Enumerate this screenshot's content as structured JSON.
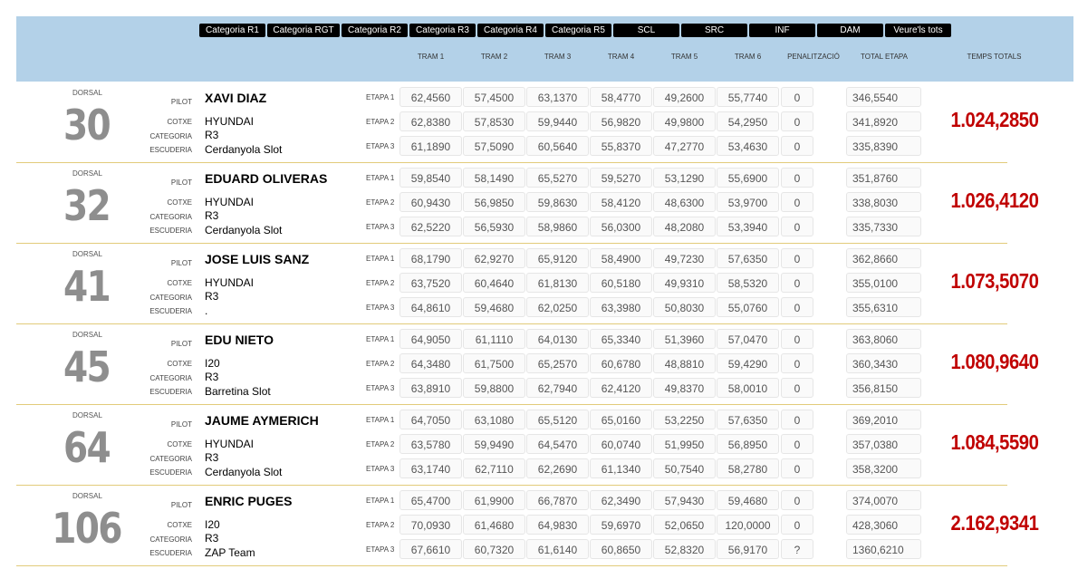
{
  "nav": [
    "Categoria R1",
    "Categoria RGT",
    "Categoria R2",
    "Categoria R3",
    "Categoria R4",
    "Categoria R5",
    "SCL",
    "SRC",
    "INF",
    "DAM",
    "Veure'ls tots"
  ],
  "headers": {
    "tram1": "TRAM 1",
    "tram2": "TRAM 2",
    "tram3": "TRAM 3",
    "tram4": "TRAM 4",
    "tram5": "TRAM 5",
    "tram6": "TRAM 6",
    "pen": "PENALITZACIÓ",
    "total_etapa": "TOTAL ETAPA",
    "temps_totals": "TEMPS TOTALS"
  },
  "labels": {
    "dorsal": "DORSAL",
    "pilot": "PILOT",
    "cotxe": "COTXE",
    "categoria": "CATEGORIA",
    "escuderia": "ESCUDERIA",
    "etapa1": "ETAPA 1",
    "etapa2": "ETAPA 2",
    "etapa3": "ETAPA 3"
  },
  "entries": [
    {
      "dorsal": "30",
      "pilot": "XAVI DIAZ",
      "cotxe": "HYUNDAI",
      "categoria": "R3",
      "escuderia": "Cerdanyola Slot",
      "total": "1.024,2850",
      "etapas": [
        {
          "t": [
            "62,4560",
            "57,4500",
            "63,1370",
            "58,4770",
            "49,2600",
            "55,7740"
          ],
          "pen": "0",
          "total": "346,5540"
        },
        {
          "t": [
            "62,8380",
            "57,8530",
            "59,9440",
            "56,9820",
            "49,9800",
            "54,2950"
          ],
          "pen": "0",
          "total": "341,8920"
        },
        {
          "t": [
            "61,1890",
            "57,5090",
            "60,5640",
            "55,8370",
            "47,2770",
            "53,4630"
          ],
          "pen": "0",
          "total": "335,8390"
        }
      ]
    },
    {
      "dorsal": "32",
      "pilot": "EDUARD OLIVERAS",
      "cotxe": "HYUNDAI",
      "categoria": "R3",
      "escuderia": "Cerdanyola Slot",
      "total": "1.026,4120",
      "etapas": [
        {
          "t": [
            "59,8540",
            "58,1490",
            "65,5270",
            "59,5270",
            "53,1290",
            "55,6900"
          ],
          "pen": "0",
          "total": "351,8760"
        },
        {
          "t": [
            "60,9430",
            "56,9850",
            "59,8630",
            "58,4120",
            "48,6300",
            "53,9700"
          ],
          "pen": "0",
          "total": "338,8030"
        },
        {
          "t": [
            "62,5220",
            "56,5930",
            "58,9860",
            "56,0300",
            "48,2080",
            "53,3940"
          ],
          "pen": "0",
          "total": "335,7330"
        }
      ]
    },
    {
      "dorsal": "41",
      "pilot": "JOSE LUIS SANZ",
      "cotxe": "HYUNDAI",
      "categoria": "R3",
      "escuderia": ".",
      "total": "1.073,5070",
      "etapas": [
        {
          "t": [
            "68,1790",
            "62,9270",
            "65,9120",
            "58,4900",
            "49,7230",
            "57,6350"
          ],
          "pen": "0",
          "total": "362,8660"
        },
        {
          "t": [
            "63,7520",
            "60,4640",
            "61,8130",
            "60,5180",
            "49,9310",
            "58,5320"
          ],
          "pen": "0",
          "total": "355,0100"
        },
        {
          "t": [
            "64,8610",
            "59,4680",
            "62,0250",
            "63,3980",
            "50,8030",
            "55,0760"
          ],
          "pen": "0",
          "total": "355,6310"
        }
      ]
    },
    {
      "dorsal": "45",
      "pilot": "EDU NIETO",
      "cotxe": "I20",
      "categoria": "R3",
      "escuderia": "Barretina Slot",
      "total": "1.080,9640",
      "etapas": [
        {
          "t": [
            "64,9050",
            "61,1110",
            "64,0130",
            "65,3340",
            "51,3960",
            "57,0470"
          ],
          "pen": "0",
          "total": "363,8060"
        },
        {
          "t": [
            "64,3480",
            "61,7500",
            "65,2570",
            "60,6780",
            "48,8810",
            "59,4290"
          ],
          "pen": "0",
          "total": "360,3430"
        },
        {
          "t": [
            "63,8910",
            "59,8800",
            "62,7940",
            "62,4120",
            "49,8370",
            "58,0010"
          ],
          "pen": "0",
          "total": "356,8150"
        }
      ]
    },
    {
      "dorsal": "64",
      "pilot": "JAUME AYMERICH",
      "cotxe": "HYUNDAI",
      "categoria": "R3",
      "escuderia": "Cerdanyola Slot",
      "total": "1.084,5590",
      "etapas": [
        {
          "t": [
            "64,7050",
            "63,1080",
            "65,5120",
            "65,0160",
            "53,2250",
            "57,6350"
          ],
          "pen": "0",
          "total": "369,2010"
        },
        {
          "t": [
            "63,5780",
            "59,9490",
            "64,5470",
            "60,0740",
            "51,9950",
            "56,8950"
          ],
          "pen": "0",
          "total": "357,0380"
        },
        {
          "t": [
            "63,1740",
            "62,7110",
            "62,2690",
            "61,1340",
            "50,7540",
            "58,2780"
          ],
          "pen": "0",
          "total": "358,3200"
        }
      ]
    },
    {
      "dorsal": "106",
      "pilot": "ENRIC PUGES",
      "cotxe": "I20",
      "categoria": "R3",
      "escuderia": "ZAP Team",
      "total": "2.162,9341",
      "etapas": [
        {
          "t": [
            "65,4700",
            "61,9900",
            "66,7870",
            "62,3490",
            "57,9430",
            "59,4680"
          ],
          "pen": "0",
          "total": "374,0070"
        },
        {
          "t": [
            "70,0930",
            "61,4680",
            "64,9830",
            "59,6970",
            "52,0650",
            "120,0000"
          ],
          "pen": "0",
          "total": "428,3060"
        },
        {
          "t": [
            "67,6610",
            "60,7320",
            "61,6140",
            "60,8650",
            "52,8320",
            "56,9170"
          ],
          "pen": "?",
          "total": "1360,6210"
        }
      ]
    }
  ]
}
